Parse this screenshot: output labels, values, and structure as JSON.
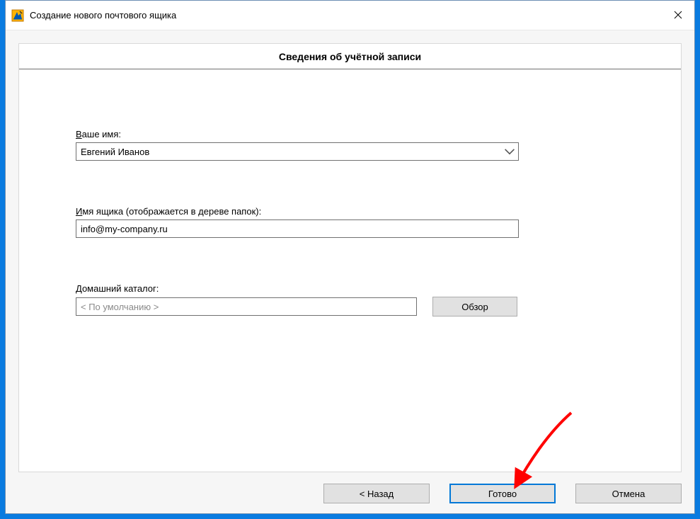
{
  "window": {
    "title": "Создание нового почтового ящика"
  },
  "section": {
    "title": "Сведения об учётной записи"
  },
  "form": {
    "name": {
      "label_first": "В",
      "label_rest": "аше имя:",
      "value": "Евгений Иванов"
    },
    "mailbox": {
      "label_first": "И",
      "label_rest": "мя ящика (отображается в дереве папок):",
      "value": "info@my-company.ru"
    },
    "home": {
      "label_first": "Д",
      "label_rest": "омашний каталог:",
      "placeholder": "< По умолчанию >",
      "browse": "Обзор"
    }
  },
  "footer": {
    "back": "<  Назад",
    "finish": "Готово",
    "cancel": "Отмена"
  }
}
